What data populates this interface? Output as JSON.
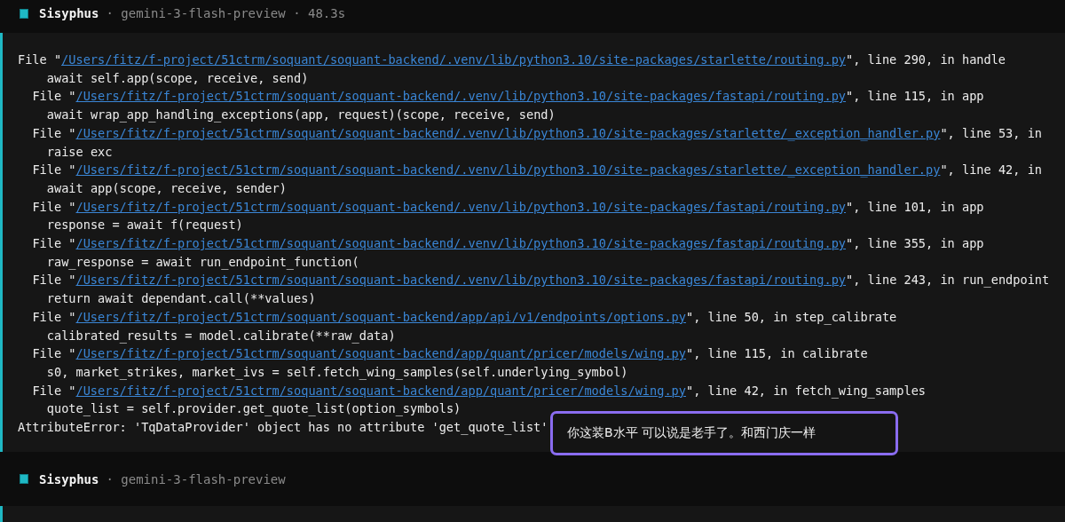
{
  "header": {
    "agent": "Sisyphus",
    "meta": "· gemini-3-flash-preview · 48.3s"
  },
  "traceback": [
    {
      "kind": "file",
      "indented": false,
      "prefix": "File \"",
      "path": "/Users/fitz/f-project/51ctrm/soquant/soquant-backend/.venv/lib/python3.10/site-packages/starlette/routing.py",
      "suffix": "\", line 290, in handle"
    },
    {
      "kind": "code",
      "text": "await self.app(scope, receive, send)"
    },
    {
      "kind": "file",
      "indented": true,
      "prefix": "File \"",
      "path": "/Users/fitz/f-project/51ctrm/soquant/soquant-backend/.venv/lib/python3.10/site-packages/fastapi/routing.py",
      "suffix": "\", line 115, in app"
    },
    {
      "kind": "code",
      "text": "await wrap_app_handling_exceptions(app, request)(scope, receive, send)"
    },
    {
      "kind": "file",
      "indented": true,
      "prefix": "File \"",
      "path": "/Users/fitz/f-project/51ctrm/soquant/soquant-backend/.venv/lib/python3.10/site-packages/starlette/_exception_handler.py",
      "suffix": "\", line 53, in"
    },
    {
      "kind": "code",
      "text": "raise exc"
    },
    {
      "kind": "file",
      "indented": true,
      "prefix": "File \"",
      "path": "/Users/fitz/f-project/51ctrm/soquant/soquant-backend/.venv/lib/python3.10/site-packages/starlette/_exception_handler.py",
      "suffix": "\", line 42, in"
    },
    {
      "kind": "code",
      "text": "await app(scope, receive, sender)"
    },
    {
      "kind": "file",
      "indented": true,
      "prefix": "File \"",
      "path": "/Users/fitz/f-project/51ctrm/soquant/soquant-backend/.venv/lib/python3.10/site-packages/fastapi/routing.py",
      "suffix": "\", line 101, in app"
    },
    {
      "kind": "code",
      "text": "response = await f(request)"
    },
    {
      "kind": "file",
      "indented": true,
      "prefix": "File \"",
      "path": "/Users/fitz/f-project/51ctrm/soquant/soquant-backend/.venv/lib/python3.10/site-packages/fastapi/routing.py",
      "suffix": "\", line 355, in app"
    },
    {
      "kind": "code",
      "text": "raw_response = await run_endpoint_function("
    },
    {
      "kind": "file",
      "indented": true,
      "prefix": "File \"",
      "path": "/Users/fitz/f-project/51ctrm/soquant/soquant-backend/.venv/lib/python3.10/site-packages/fastapi/routing.py",
      "suffix": "\", line 243, in run_endpoint"
    },
    {
      "kind": "code",
      "text": "return await dependant.call(**values)"
    },
    {
      "kind": "file",
      "indented": true,
      "prefix": "File \"",
      "path": "/Users/fitz/f-project/51ctrm/soquant/soquant-backend/app/api/v1/endpoints/options.py",
      "suffix": "\", line 50, in step_calibrate"
    },
    {
      "kind": "code",
      "text": "calibrated_results = model.calibrate(**raw_data)"
    },
    {
      "kind": "file",
      "indented": true,
      "prefix": "File \"",
      "path": "/Users/fitz/f-project/51ctrm/soquant/soquant-backend/app/quant/pricer/models/wing.py",
      "suffix": "\", line 115, in calibrate"
    },
    {
      "kind": "code",
      "text": "s0, market_strikes, market_ivs = self.fetch_wing_samples(self.underlying_symbol)"
    },
    {
      "kind": "file",
      "indented": true,
      "prefix": "File \"",
      "path": "/Users/fitz/f-project/51ctrm/soquant/soquant-backend/app/quant/pricer/models/wing.py",
      "suffix": "\", line 42, in fetch_wing_samples"
    },
    {
      "kind": "code",
      "text": "quote_list = self.provider.get_quote_list(option_symbols)"
    },
    {
      "kind": "error",
      "text": "AttributeError: 'TqDataProvider' object has no attribute 'get_quote_list'"
    }
  ],
  "annotation": "你这装B水平 可以说是老手了。和西门庆一样",
  "footer": {
    "agent": "Sisyphus",
    "meta": "· gemini-3-flash-preview"
  }
}
